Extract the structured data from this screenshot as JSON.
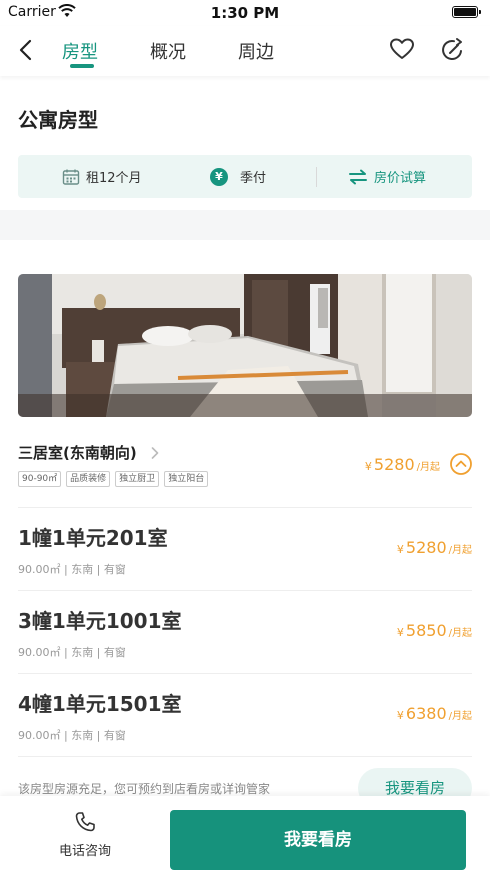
{
  "status_bar": {
    "carrier": "Carrier",
    "time": "1:30 PM"
  },
  "nav": {
    "tabs": [
      {
        "label": "房型",
        "active": true
      },
      {
        "label": "概况",
        "active": false
      },
      {
        "label": "周边",
        "active": false
      }
    ],
    "icons": [
      "back-arrow-icon",
      "heart-icon",
      "share-icon"
    ],
    "accent_color": "#17957f"
  },
  "section": {
    "title": "公寓房型"
  },
  "info_strip": {
    "lease": "租12个月",
    "payment": "季付",
    "calculator": "房价试算"
  },
  "layout": {
    "title": "三居室(东南朝向)",
    "tags": [
      "90-90㎡",
      "品质装修",
      "独立厨卫",
      "独立阳台"
    ],
    "price_symbol": "¥",
    "price": "5280",
    "price_unit": "/月起",
    "price_color": "#f0a030"
  },
  "units": [
    {
      "name": "1幢1单元201室",
      "meta": "90.00㎡ | 东南 | 有窗",
      "price_symbol": "¥",
      "price": "5280",
      "price_unit": "/月起"
    },
    {
      "name": "3幢1单元1001室",
      "meta": "90.00㎡ | 东南 | 有窗",
      "price_symbol": "¥",
      "price": "5850",
      "price_unit": "/月起"
    },
    {
      "name": "4幢1单元1501室",
      "meta": "90.00㎡ | 东南 | 有窗",
      "price_symbol": "¥",
      "price": "6380",
      "price_unit": "/月起"
    }
  ],
  "footer": {
    "hint": "该房型房源充足，您可预约到店看房或详询管家",
    "visit_pill": "我要看房",
    "phone_label": "电话咨询",
    "primary_button": "我要看房"
  }
}
